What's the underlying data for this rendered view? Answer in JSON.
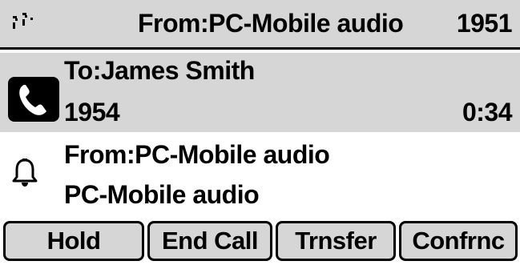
{
  "header": {
    "line_icon": "line-status-icon",
    "from_label": "From:PC-Mobile audio",
    "extension": "1951"
  },
  "active_call": {
    "icon": "phone-handset-icon",
    "to_label": "To:James Smith",
    "number": "1954",
    "duration": "0:34"
  },
  "incoming_call": {
    "icon": "bell-icon",
    "from_label": "From:PC-Mobile audio",
    "caller_name": "PC-Mobile audio"
  },
  "softkeys": [
    {
      "label": "Hold"
    },
    {
      "label": "End Call"
    },
    {
      "label": "Trnsfer"
    },
    {
      "label": "Confrnc"
    }
  ],
  "colors": {
    "highlight": "#d6d6d6",
    "text": "#000000",
    "background": "#ffffff"
  }
}
